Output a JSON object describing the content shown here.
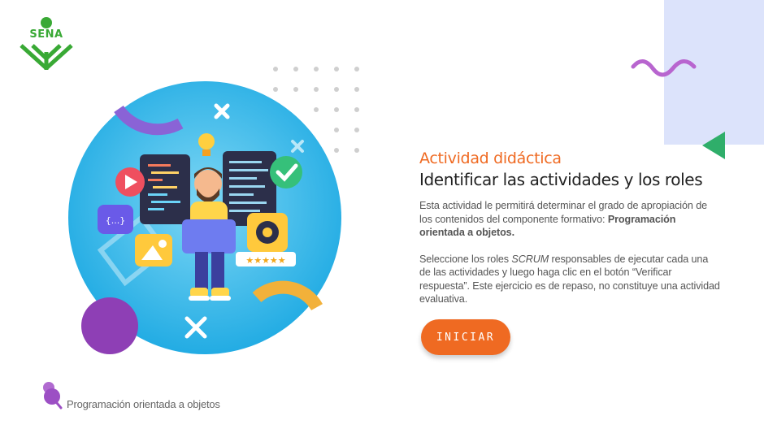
{
  "brand": {
    "logo_text": "SENA"
  },
  "activity": {
    "subtitle": "Actividad didáctica",
    "title": "Identificar las actividades y los roles",
    "intro_part1": "Esta actividad le permitirá determinar el grado de apropiación de los contenidos del componente formativo: ",
    "intro_bold": "Programación orientada a objetos.",
    "instr_part1": "Seleccione los roles ",
    "instr_italic": "SCRUM",
    "instr_part2": " responsables de ejecutar cada una de las actividades y luego haga clic en el botón “Verificar respuesta”.  Este ejercicio es de repaso, no constituye una actividad evaluativa.",
    "start_button": "INICIAR"
  },
  "illustration": {
    "code_brace": "{...}",
    "rating": "★★★★★"
  },
  "footer": {
    "course_name": "Programación orientada a objetos"
  },
  "colors": {
    "accent": "#ef6a22",
    "brand_green": "#39a935",
    "circle_blue": "#29b6ea",
    "purple": "#8e3fb5",
    "panel_lavender": "#dce3fb"
  }
}
